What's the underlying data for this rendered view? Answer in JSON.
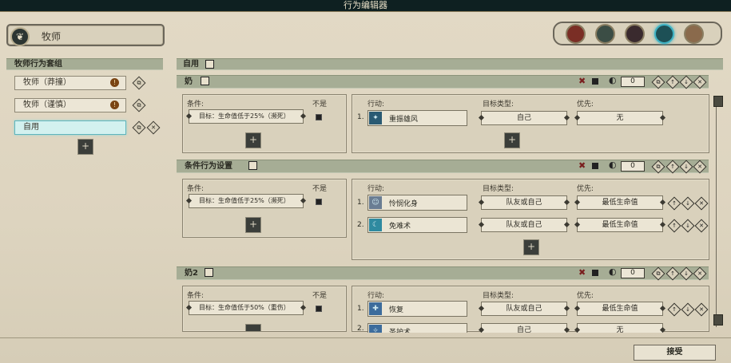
{
  "window": {
    "title": "行为编辑器"
  },
  "class": {
    "name": "牧师",
    "icon": "leaf-icon"
  },
  "portraits": [
    {
      "name": "portrait-1",
      "color": "#7a2e25"
    },
    {
      "name": "portrait-2",
      "color": "#3b4d45"
    },
    {
      "name": "portrait-3",
      "color": "#3a2a2e"
    },
    {
      "name": "portrait-4",
      "color": "#1d5056",
      "selected": true
    },
    {
      "name": "portrait-5",
      "color": "#8a6a4c"
    }
  ],
  "sidebar": {
    "header": "牧师行为套组",
    "items": [
      {
        "label": "牧师（莽撞）",
        "warning": "!",
        "selected": false
      },
      {
        "label": "牧师（谨慎）",
        "warning": "!",
        "selected": false
      },
      {
        "label": "自用",
        "selected": true
      }
    ],
    "add": "+"
  },
  "main": {
    "header": "自用",
    "labels": {
      "condition": "条件:",
      "not": "不是",
      "action": "行动:",
      "target_type": "目标类型:",
      "priority": "优先:"
    },
    "sections": [
      {
        "title": "奶",
        "count": "0",
        "condition": "目标：生命值低于25%（濒死）",
        "actions": [
          {
            "index": "1.",
            "skill": "重振雄风",
            "target": "自己",
            "priority": "无"
          }
        ]
      },
      {
        "title": "条件行为设置",
        "count": "0",
        "condition": "目标：生命值低于25%（濒死）",
        "actions": [
          {
            "index": "1.",
            "skill": "怜悯化身",
            "target": "队友或自己",
            "priority": "最低生命值"
          },
          {
            "index": "2.",
            "skill": "免难术",
            "target": "队友或自己",
            "priority": "最低生命值"
          }
        ]
      },
      {
        "title": "奶2",
        "count": "0",
        "condition": "目标：生命值低于50%（重伤）",
        "actions": [
          {
            "index": "1.",
            "skill": "恢复",
            "target": "队友或自己",
            "priority": "最低生命值"
          },
          {
            "index": "2.",
            "skill": "圣护术",
            "target": "自己",
            "priority": "无"
          }
        ]
      }
    ]
  },
  "footer": {
    "accept": "接受"
  }
}
